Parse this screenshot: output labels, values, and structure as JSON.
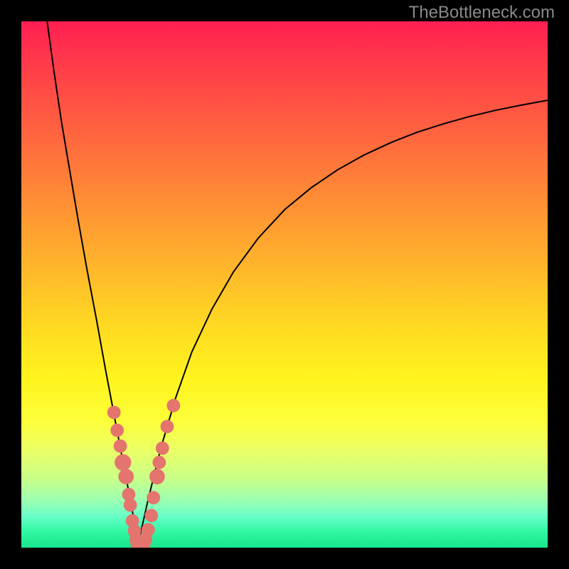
{
  "watermark": "TheBottleneck.com",
  "colors": {
    "curve_stroke": "#000000",
    "marker_fill": "#e4746e",
    "marker_stroke": "#e4746e",
    "background_black": "#000000"
  },
  "chart_data": {
    "type": "line",
    "title": "",
    "xlabel": "",
    "ylabel": "",
    "xlim": [
      0,
      100
    ],
    "ylim": [
      0,
      100
    ],
    "grid": false,
    "legend": false,
    "series": [
      {
        "name": "left-curve",
        "x": [
          4.9,
          6.2,
          7.6,
          9.2,
          10.8,
          12.5,
          14.3,
          16.0,
          17.8,
          19.2,
          20.8,
          22.2
        ],
        "y": [
          100,
          90.5,
          81.1,
          71.6,
          62.2,
          52.7,
          43.2,
          33.8,
          24.3,
          16.9,
          8.6,
          0.7
        ]
      },
      {
        "name": "right-curve",
        "x": [
          22.2,
          24.1,
          26.5,
          29.3,
          32.4,
          36.2,
          40.3,
          45.0,
          50.1,
          55.1,
          60.1,
          65.1,
          70.3,
          75.1,
          80.1,
          85.1,
          90.1,
          95.1,
          100.0
        ],
        "y": [
          0.7,
          9.2,
          18.9,
          28.4,
          37.2,
          45.3,
          52.4,
          58.8,
          64.3,
          68.4,
          71.8,
          74.6,
          77.0,
          78.9,
          80.5,
          81.9,
          83.1,
          84.1,
          85.0
        ]
      }
    ],
    "markers": [
      {
        "x": 17.6,
        "y": 25.7,
        "r": 1.2
      },
      {
        "x": 18.2,
        "y": 22.3,
        "r": 1.2
      },
      {
        "x": 18.8,
        "y": 19.3,
        "r": 1.2
      },
      {
        "x": 19.3,
        "y": 16.2,
        "r": 1.5
      },
      {
        "x": 19.9,
        "y": 13.5,
        "r": 1.4
      },
      {
        "x": 20.4,
        "y": 10.1,
        "r": 1.2
      },
      {
        "x": 20.7,
        "y": 8.1,
        "r": 1.2
      },
      {
        "x": 21.1,
        "y": 5.1,
        "r": 1.2
      },
      {
        "x": 21.5,
        "y": 3.2,
        "r": 1.2
      },
      {
        "x": 21.8,
        "y": 1.6,
        "r": 1.2
      },
      {
        "x": 22.2,
        "y": 0.8,
        "r": 1.4
      },
      {
        "x": 22.7,
        "y": 0.7,
        "r": 1.4
      },
      {
        "x": 23.1,
        "y": 0.8,
        "r": 1.4
      },
      {
        "x": 23.6,
        "y": 1.6,
        "r": 1.2
      },
      {
        "x": 24.1,
        "y": 3.4,
        "r": 1.2
      },
      {
        "x": 24.7,
        "y": 6.1,
        "r": 1.2
      },
      {
        "x": 25.1,
        "y": 9.5,
        "r": 1.2
      },
      {
        "x": 25.8,
        "y": 13.5,
        "r": 1.4
      },
      {
        "x": 26.2,
        "y": 16.2,
        "r": 1.2
      },
      {
        "x": 26.8,
        "y": 18.9,
        "r": 1.2
      },
      {
        "x": 27.7,
        "y": 23.0,
        "r": 1.2
      },
      {
        "x": 28.9,
        "y": 27.0,
        "r": 1.2
      }
    ]
  }
}
